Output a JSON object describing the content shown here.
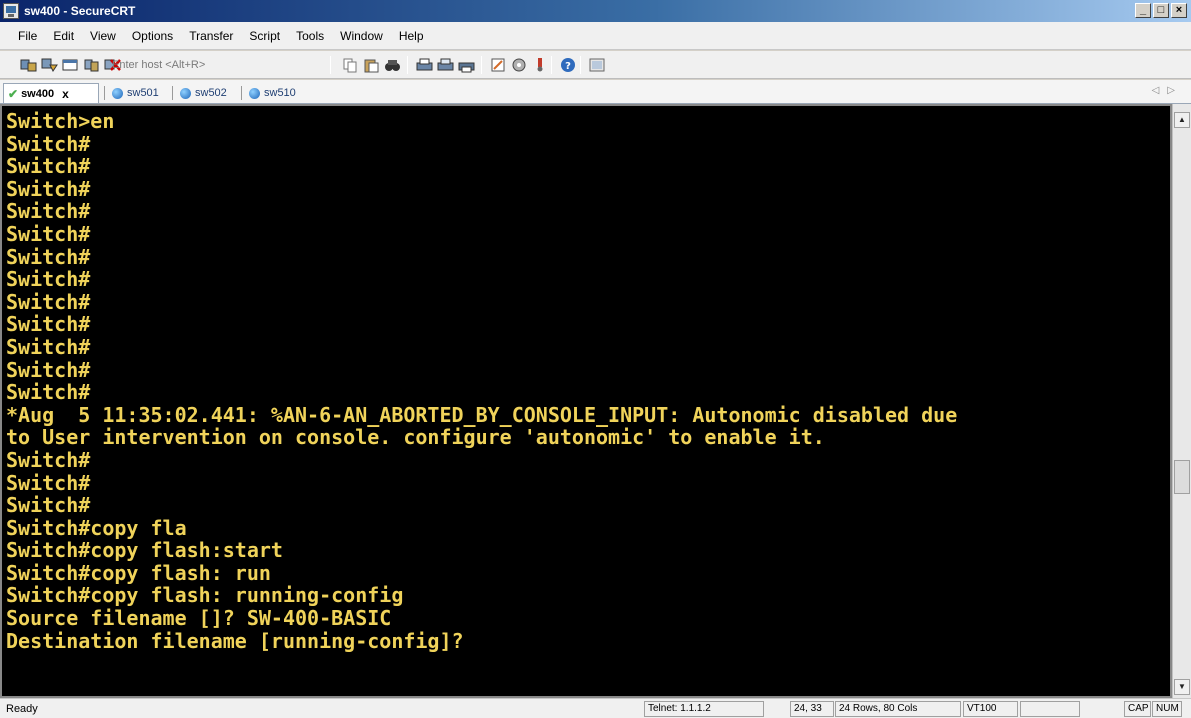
{
  "window": {
    "title": "sw400 - SecureCRT",
    "buttons": {
      "minimize": "_",
      "maximize": "□",
      "close": "×"
    }
  },
  "menu": [
    "File",
    "Edit",
    "View",
    "Options",
    "Transfer",
    "Script",
    "Tools",
    "Window",
    "Help"
  ],
  "toolbar": {
    "host_placeholder": "Enter host <Alt+R>",
    "icons": [
      "connect-icon",
      "quick-connect-icon",
      "connect-in-tab-icon",
      "reconnect-icon",
      "disconnect-icon",
      "copy-icon",
      "paste-icon",
      "find-icon",
      "print-icon",
      "print-selection-icon",
      "printer-icon",
      "session-options-icon",
      "global-options-icon",
      "keymap-icon",
      "help-icon",
      "sftp-icon"
    ]
  },
  "tabs": [
    {
      "label": "sw400",
      "active": true,
      "close": "x"
    },
    {
      "label": "sw501",
      "active": false
    },
    {
      "label": "sw502",
      "active": false
    },
    {
      "label": "sw510",
      "active": false
    }
  ],
  "terminal": {
    "text_color": "#f0d35a",
    "background": "#000000",
    "lines": [
      "Switch>en",
      "Switch#",
      "Switch#",
      "Switch#",
      "Switch#",
      "Switch#",
      "Switch#",
      "Switch#",
      "Switch#",
      "Switch#",
      "Switch#",
      "Switch#",
      "Switch#",
      "*Aug  5 11:35:02.441: %AN-6-AN_ABORTED_BY_CONSOLE_INPUT: Autonomic disabled due",
      "to User intervention on console. configure 'autonomic' to enable it.",
      "Switch#",
      "Switch#",
      "Switch#",
      "Switch#copy fla",
      "Switch#copy flash:start",
      "Switch#copy flash: run",
      "Switch#copy flash: running-config",
      "Source filename []? SW-400-BASIC",
      "Destination filename [running-config]?"
    ]
  },
  "status": {
    "ready": "Ready",
    "connection": "Telnet: 1.1.1.2",
    "cursor": "24,  33",
    "size": "24 Rows, 80 Cols",
    "emulation": "VT100",
    "caps": "CAP",
    "num": "NUM"
  }
}
